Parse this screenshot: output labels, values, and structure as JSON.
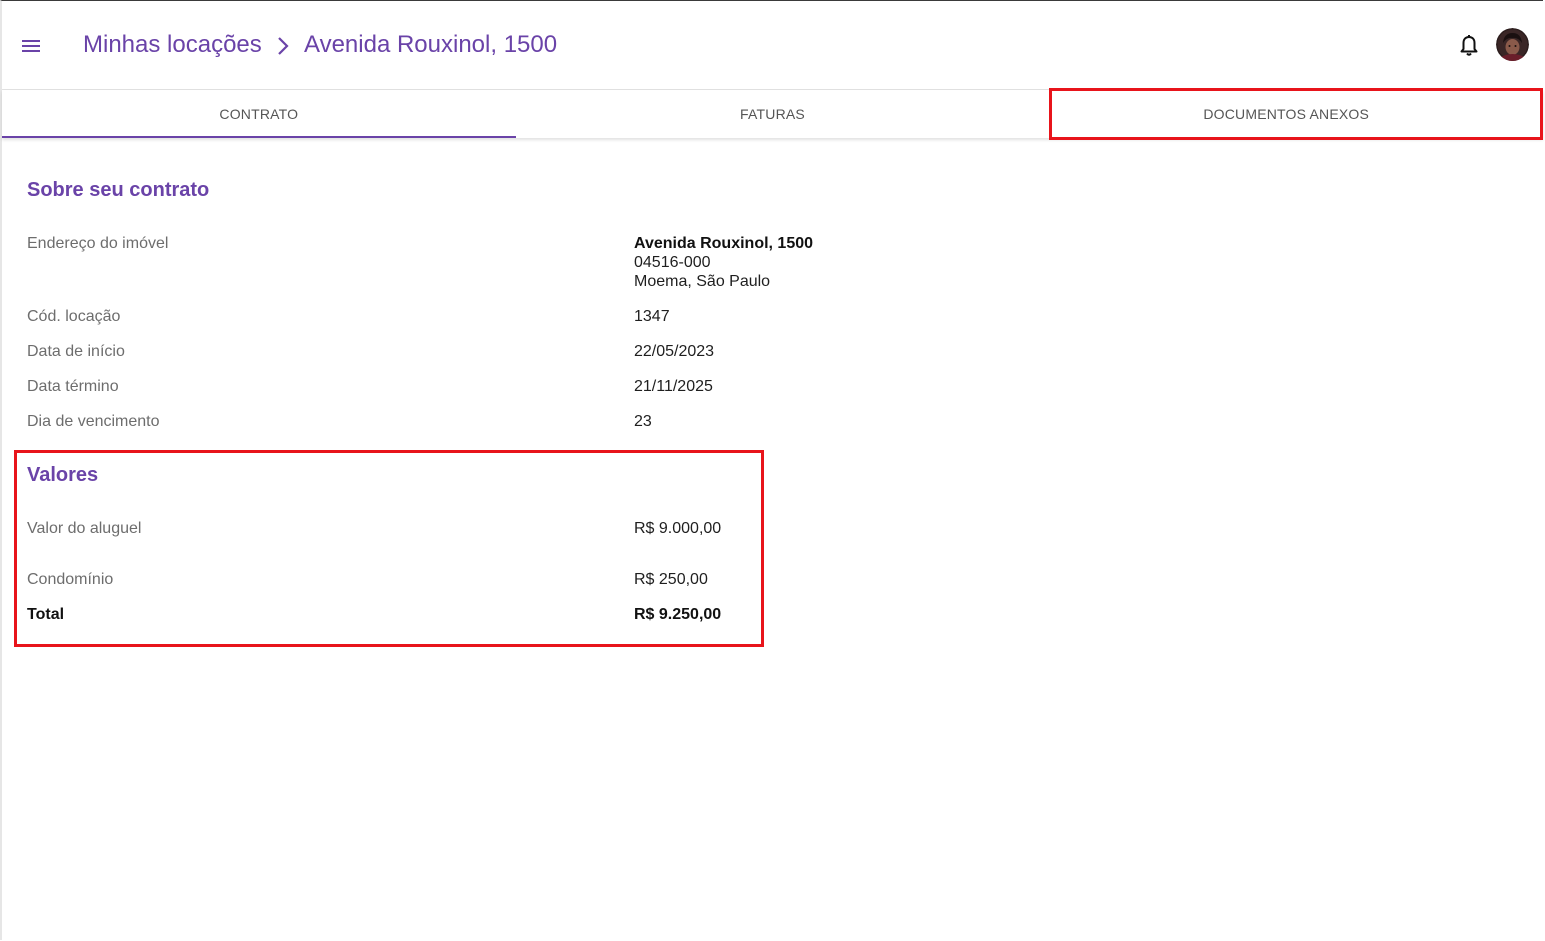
{
  "header": {
    "menu_icon": "menu-icon",
    "breadcrumb": {
      "parent": "Minhas locações",
      "separator_icon": "chevron-right-icon",
      "current": "Avenida Rouxinol, 1500"
    },
    "notification_icon": "bell-icon",
    "avatar_icon": "user-avatar"
  },
  "tabs": [
    {
      "label": "CONTRATO",
      "active": true
    },
    {
      "label": "FATURAS",
      "active": false
    },
    {
      "label": "DOCUMENTOS ANEXOS",
      "active": false
    }
  ],
  "contract": {
    "title": "Sobre seu contrato",
    "address_label": "Endereço do imóvel",
    "address_line1": "Avenida Rouxinol, 1500",
    "address_line2": "04516-000",
    "address_line3": "Moema, São Paulo",
    "code_label": "Cód. locação",
    "code_value": "1347",
    "start_label": "Data de início",
    "start_value": "22/05/2023",
    "end_label": "Data término",
    "end_value": "21/11/2025",
    "due_label": "Dia de vencimento",
    "due_value": "23"
  },
  "values": {
    "title": "Valores",
    "rent_label": "Valor do aluguel",
    "rent_value": "R$ 9.000,00",
    "condo_label": "Condomínio",
    "condo_value": "R$ 250,00",
    "total_label": "Total",
    "total_value": "R$ 9.250,00"
  },
  "colors": {
    "accent": "#6a43a8",
    "highlight": "#e8141b"
  }
}
